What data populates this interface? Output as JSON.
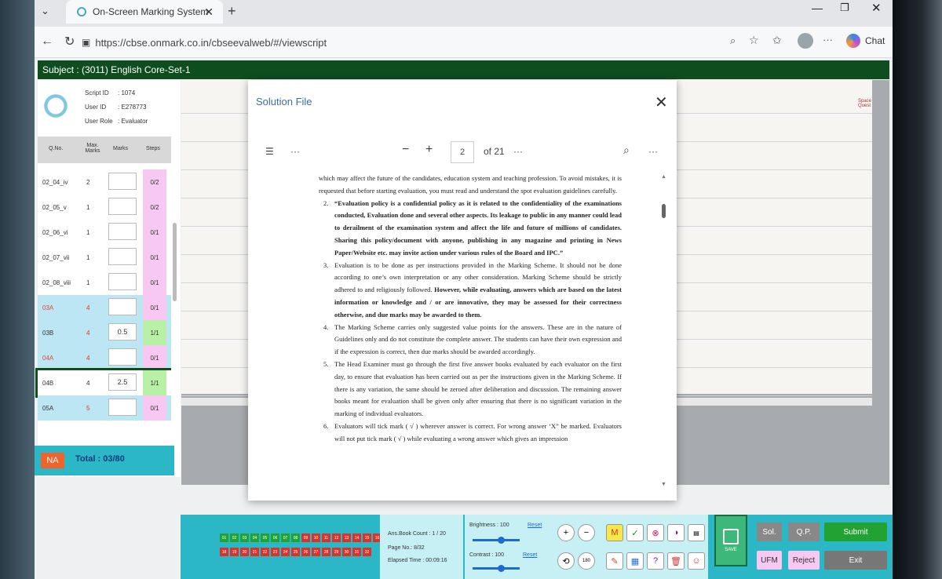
{
  "browser": {
    "tab_title": "On-Screen Marking System",
    "url": "https://cbse.onmark.co.in/cbseevalweb/#/viewscript",
    "chat_label": "Chat"
  },
  "subject_bar": "Subject : (3011) English Core-Set-1",
  "info": {
    "script_id_label": "Script ID",
    "script_id": ": 1074",
    "user_id_label": "User ID",
    "user_id": ": E278773",
    "role_label": "User Role",
    "role": ": Evaluator"
  },
  "table_header": {
    "q": "Q.No.",
    "max": "Max. Marks",
    "marks": "Marks",
    "steps": "Steps"
  },
  "rows": [
    {
      "q": "02_04_iv",
      "max": "2",
      "marks": "",
      "steps": "0/2"
    },
    {
      "q": "02_05_v",
      "max": "1",
      "marks": "",
      "steps": "0/2"
    },
    {
      "q": "02_06_vi",
      "max": "1",
      "marks": "",
      "steps": "0/1"
    },
    {
      "q": "02_07_vii",
      "max": "1",
      "marks": "",
      "steps": "0/1"
    },
    {
      "q": "02_08_viii",
      "max": "1",
      "marks": "",
      "steps": "0/1"
    },
    {
      "q": "03A",
      "max": "4",
      "marks": "",
      "steps": "0/1"
    },
    {
      "q": "03B",
      "max": "4",
      "marks": "0.5",
      "steps": "1/1"
    },
    {
      "q": "04A",
      "max": "4",
      "marks": "",
      "steps": "0/1"
    },
    {
      "q": "04B",
      "max": "4",
      "marks": "2.5",
      "steps": "1/1"
    },
    {
      "q": "05A",
      "max": "5",
      "marks": "",
      "steps": "0/1"
    }
  ],
  "na_label": "NA",
  "total": "Total : 03/80",
  "modal": {
    "title": "Solution File",
    "page": "2",
    "of_pages": "of 21",
    "intro": "which may affect the future of the candidates, education system and teaching profession. To avoid mistakes, it is requested that before starting evaluation, you must read and understand the spot evaluation guidelines carefully.",
    "items": [
      {
        "n": "2.",
        "text": "“Evaluation policy is a confidential policy as it is related to the confidentiality of the examinations conducted, Evaluation done and several other aspects. Its leakage to public in any manner could lead to derailment of the examination system and affect the life and future of millions of candidates. Sharing this policy/document with anyone, publishing in any magazine and printing in News Paper/Website etc. may invite action under various rules of the Board and IPC.”",
        "bold": true
      },
      {
        "n": "3.",
        "text": "Evaluation is to be done as per instructions provided in the Marking Scheme. It should not be done according to one’s own interpretation or any other consideration. Marking Scheme should be strictly adhered to and religiously followed.",
        "bold_tail": "However, while evaluating, answers which are based on the latest information or knowledge and / or are innovative, they may be assessed for their correctness otherwise, and due marks may be awarded to them."
      },
      {
        "n": "4.",
        "text": "The Marking Scheme carries only suggested value points for the answers. These are in the nature of Guidelines only and do not constitute the complete answer. The students can have their own expression and if the expression is correct, then due marks should be awarded accordingly."
      },
      {
        "n": "5.",
        "text": "The Head Examiner must go through the first five answer books evaluated by each evaluator on the first day, to ensure that evaluation has been carried out as per the instructions given in the Marking Scheme. If there is any variation, the same should be zeroed after deliberation and discussion. The remaining answer books meant for evaluation shall be given only after ensuring that there is no significant variation in the marking of individual evaluators."
      },
      {
        "n": "6.",
        "text": "Evaluators will tick mark ( √ ) wherever answer is correct. For wrong answer ‘X” be marked. Evaluators will not put tick mark ( √ ) while evaluating a wrong answer which gives an impression"
      }
    ]
  },
  "page_buttons_row1": [
    "01",
    "02",
    "03",
    "04",
    "05",
    "06",
    "07",
    "08",
    "09",
    "10",
    "11",
    "12",
    "13",
    "14",
    "15",
    "16",
    "17"
  ],
  "page_buttons_row2": [
    "18",
    "19",
    "20",
    "21",
    "22",
    "23",
    "24",
    "25",
    "26",
    "27",
    "28",
    "29",
    "30",
    "31",
    "32"
  ],
  "status": {
    "ans_book": "Ans.Book Count : 1 / 20",
    "page_no": "Page No.: 8/32",
    "elapsed": "Elapsed Time : 00:09:16"
  },
  "controls": {
    "brightness": "Brightness : 100",
    "contrast": "Contrast : 100",
    "reset": "Reset",
    "brightness_level": 0.6,
    "contrast_level": 0.6
  },
  "tool_m": "M",
  "save_label": "SAVE",
  "actions": {
    "sol": "Sol.",
    "qp": "Q.P.",
    "submit": "Submit",
    "ufm": "UFM",
    "reject": "Reject",
    "exit": "Exit"
  },
  "paper_margin_text": "Space Quest",
  "colors": {
    "green_bar": "#0e4d1e",
    "teal": "#2bb7c6",
    "red_page": "#d9342b",
    "green_page": "#22a233",
    "pink_steps": "#f7c9f2"
  }
}
